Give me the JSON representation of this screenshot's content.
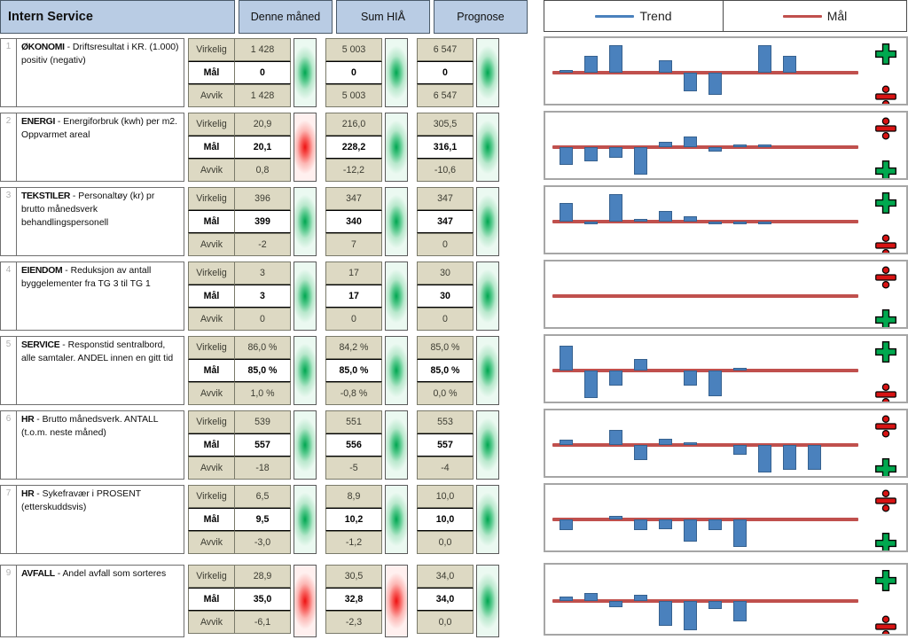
{
  "header": {
    "title": "Intern Service",
    "columns": [
      "Denne måned",
      "Sum HIÅ",
      "Prognose"
    ]
  },
  "measure_labels": {
    "actual": "Virkelig",
    "target": "Mål",
    "deviation": "Avvik"
  },
  "legend": {
    "trend": {
      "label": "Trend",
      "color": "#4a81bd"
    },
    "target": {
      "label": "Mål",
      "color": "#c0504d"
    }
  },
  "colors": {
    "header_bg": "#b9cce4",
    "cell_beige": "#ddd9c3",
    "bar_blue": "#4a81bd",
    "target_red": "#c0504d",
    "status_green": "#00a651",
    "status_red": "#ee1111"
  },
  "rows": [
    {
      "index": "1",
      "name": "ØKONOMI",
      "desc": " - Driftsresultat i KR. (1.000) positiv (negativ)",
      "month": {
        "actual": "1 428",
        "target": "0",
        "deviation": "1 428",
        "status": "green"
      },
      "ytd": {
        "actual": "5 003",
        "target": "0",
        "deviation": "5 003",
        "status": "green"
      },
      "forecast": {
        "actual": "6 547",
        "target": "0",
        "deviation": "6 547",
        "status": "green"
      },
      "icon_top": "plus-green",
      "icon_bottom": "divide-red"
    },
    {
      "index": "2",
      "name": "ENERGI",
      "desc": " - Energiforbruk (kwh) per m2. Oppvarmet areal",
      "month": {
        "actual": "20,9",
        "target": "20,1",
        "deviation": "0,8",
        "status": "red"
      },
      "ytd": {
        "actual": "216,0",
        "target": "228,2",
        "deviation": "-12,2",
        "status": "green"
      },
      "forecast": {
        "actual": "305,5",
        "target": "316,1",
        "deviation": "-10,6",
        "status": "green"
      },
      "icon_top": "divide-red",
      "icon_bottom": "plus-green"
    },
    {
      "index": "3",
      "name": "TEKSTILER",
      "desc": " - Personaltøy (kr) pr brutto månedsverk behandlingspersonell",
      "month": {
        "actual": "396",
        "target": "399",
        "deviation": "-2",
        "status": "green"
      },
      "ytd": {
        "actual": "347",
        "target": "340",
        "deviation": "7",
        "status": "green"
      },
      "forecast": {
        "actual": "347",
        "target": "347",
        "deviation": "0",
        "status": "green"
      },
      "icon_top": "plus-green",
      "icon_bottom": "divide-red"
    },
    {
      "index": "4",
      "name": "EIENDOM",
      "desc": " - Reduksjon av antall byggelementer fra  TG 3 til TG 1",
      "month": {
        "actual": "3",
        "target": "3",
        "deviation": "0",
        "status": "green"
      },
      "ytd": {
        "actual": "17",
        "target": "17",
        "deviation": "0",
        "status": "green"
      },
      "forecast": {
        "actual": "30",
        "target": "30",
        "deviation": "0",
        "status": "green"
      },
      "icon_top": "divide-red",
      "icon_bottom": "plus-green"
    },
    {
      "index": "5",
      "name": "SERVICE",
      "desc": " - Responstid sentralbord, alle samtaler. ANDEL innen en gitt tid",
      "month": {
        "actual": "86,0 %",
        "target": "85,0 %",
        "deviation": "1,0 %",
        "status": "green"
      },
      "ytd": {
        "actual": "84,2 %",
        "target": "85,0 %",
        "deviation": "-0,8 %",
        "status": "green"
      },
      "forecast": {
        "actual": "85,0 %",
        "target": "85,0 %",
        "deviation": "0,0 %",
        "status": "green"
      },
      "icon_top": "plus-green",
      "icon_bottom": "divide-red"
    },
    {
      "index": "6",
      "name": "HR",
      "desc": " - Brutto månedsverk. ANTALL (t.o.m. neste måned)",
      "month": {
        "actual": "539",
        "target": "557",
        "deviation": "-18",
        "status": "green"
      },
      "ytd": {
        "actual": "551",
        "target": "556",
        "deviation": "-5",
        "status": "green"
      },
      "forecast": {
        "actual": "553",
        "target": "557",
        "deviation": "-4",
        "status": "green"
      },
      "icon_top": "divide-red",
      "icon_bottom": "plus-green"
    },
    {
      "index": "7",
      "name": "HR",
      "desc": " - Sykefravær i PROSENT (etterskuddsvis)",
      "month": {
        "actual": "6,5",
        "target": "9,5",
        "deviation": "-3,0",
        "status": "green"
      },
      "ytd": {
        "actual": "8,9",
        "target": "10,2",
        "deviation": "-1,2",
        "status": "green"
      },
      "forecast": {
        "actual": "10,0",
        "target": "10,0",
        "deviation": "0,0",
        "status": "green"
      },
      "icon_top": "divide-red",
      "icon_bottom": "plus-green"
    },
    {
      "index": "9",
      "name": "AVFALL",
      "desc": " - Andel avfall som sorteres",
      "month": {
        "actual": "28,9",
        "target": "35,0",
        "deviation": "-6,1",
        "status": "red"
      },
      "ytd": {
        "actual": "30,5",
        "target": "32,8",
        "deviation": "-2,3",
        "status": "red"
      },
      "forecast": {
        "actual": "34,0",
        "target": "34,0",
        "deviation": "0,0",
        "status": "green"
      },
      "icon_top": "plus-green",
      "icon_bottom": "divide-red"
    }
  ],
  "chart_data": [
    {
      "type": "bar",
      "title": "ØKONOMI trend",
      "series": [
        {
          "name": "Trend",
          "values": [
            0.5,
            10,
            16,
            0,
            7,
            -11,
            -13,
            0,
            16,
            10,
            0,
            0
          ]
        }
      ],
      "target_line": 0,
      "ylabel": "",
      "xlabel": "",
      "grid": false,
      "legend": "top"
    },
    {
      "type": "bar",
      "title": "ENERGI trend",
      "series": [
        {
          "name": "Trend",
          "values": [
            -13,
            -10,
            -8,
            -20,
            4,
            8,
            -3,
            1,
            2,
            0,
            0,
            0
          ]
        }
      ],
      "target_line": 0,
      "ylabel": "",
      "xlabel": "",
      "grid": false,
      "legend": "top"
    },
    {
      "type": "bar",
      "title": "TEKSTILER trend",
      "series": [
        {
          "name": "Trend",
          "values": [
            16,
            -1,
            24,
            1,
            9,
            5,
            -2,
            -2,
            -1,
            0,
            0,
            0
          ]
        }
      ],
      "target_line": 0,
      "ylabel": "",
      "xlabel": "",
      "grid": false,
      "legend": "top"
    },
    {
      "type": "bar",
      "title": "EIENDOM trend",
      "series": [
        {
          "name": "Trend",
          "values": []
        }
      ],
      "target_line": 0,
      "ylabel": "",
      "xlabel": "",
      "grid": false,
      "legend": "top"
    },
    {
      "type": "bar",
      "title": "SERVICE trend",
      "series": [
        {
          "name": "Trend",
          "values": [
            15,
            -17,
            -9,
            7,
            0,
            -9,
            -16,
            1,
            0,
            0,
            0,
            0
          ]
        }
      ],
      "target_line": 0,
      "ylabel": "",
      "xlabel": "",
      "grid": false,
      "legend": "top"
    },
    {
      "type": "bar",
      "title": "HR månedsverk trend",
      "series": [
        {
          "name": "Trend",
          "values": [
            4,
            0,
            12,
            -12,
            5,
            2,
            0,
            -8,
            -22,
            -20,
            -20,
            0
          ]
        }
      ],
      "target_line": 0,
      "ylabel": "",
      "xlabel": "",
      "grid": false,
      "legend": "top"
    },
    {
      "type": "bar",
      "title": "HR sykefravær trend",
      "series": [
        {
          "name": "Trend",
          "values": [
            -11,
            0,
            4,
            -11,
            -10,
            -22,
            -11,
            -28,
            0,
            0,
            0,
            0
          ]
        }
      ],
      "target_line": 0,
      "ylabel": "",
      "xlabel": "",
      "grid": false,
      "legend": "top"
    },
    {
      "type": "bar",
      "title": "AVFALL trend",
      "series": [
        {
          "name": "Trend",
          "values": [
            2,
            4,
            -3,
            3,
            -12,
            -14,
            -4,
            -10,
            0,
            0,
            0,
            0
          ]
        }
      ],
      "target_line": 0,
      "ylabel": "",
      "xlabel": "",
      "grid": false,
      "legend": "top"
    }
  ]
}
